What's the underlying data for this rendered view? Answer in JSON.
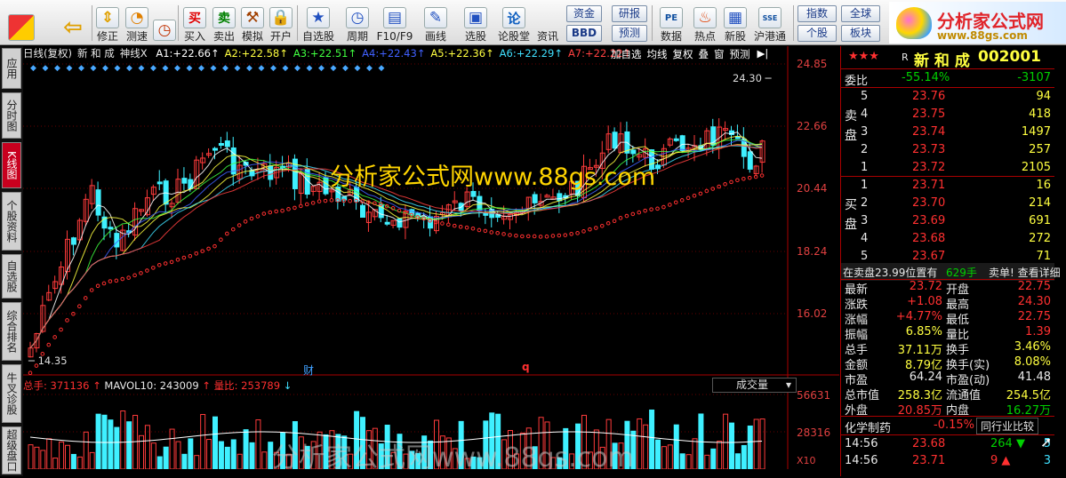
{
  "toolbar": {
    "buttons": [
      {
        "label": "",
        "icon": "home-icon"
      },
      {
        "label": "",
        "icon": "back-arrow-icon"
      },
      {
        "label": "修正",
        "icon": "up-down-icon"
      },
      {
        "label": "测速",
        "icon": "speed-icon"
      },
      {
        "label": "买入",
        "icon": "buy-icon"
      },
      {
        "label": "卖出",
        "icon": "sell-icon"
      },
      {
        "label": "模拟",
        "icon": "hammer-icon"
      },
      {
        "label": "开户",
        "icon": "lock-icon"
      },
      {
        "label": "自选股",
        "icon": "star-icon"
      },
      {
        "label": "周期",
        "icon": "clock-icon"
      },
      {
        "label": "F10/F9",
        "icon": "f10-icon"
      },
      {
        "label": "画线",
        "icon": "pen-icon"
      },
      {
        "label": "选股",
        "icon": "select-icon"
      },
      {
        "label": "论股堂",
        "icon": "forum-icon"
      },
      {
        "label": "资讯",
        "icon": "news-icon"
      },
      {
        "label": "数据",
        "icon": "pe-icon"
      },
      {
        "label": "热点",
        "icon": "hot-icon"
      },
      {
        "label": "新股",
        "icon": "newstock-icon"
      },
      {
        "label": "沪港通",
        "icon": "sse-hke-icon"
      }
    ],
    "small_buttons": [
      "资金",
      "BBD",
      "研报",
      "预测",
      "指数",
      "个股",
      "全球",
      "板块"
    ],
    "icon_glyphs": {
      "buy": "买",
      "sell": "卖",
      "forum": "论"
    }
  },
  "logo": {
    "title": "分析家公式网",
    "url": "www.88gs.com"
  },
  "left_tabs": [
    "应用",
    "分时图",
    "K线图",
    "个股资料",
    "自选股",
    "综合排名",
    "牛叉诊股",
    "超级盘口"
  ],
  "chart": {
    "period_label": "日线(复权)",
    "stock_name": "新 和 成",
    "indicator_name": "神线X",
    "ma": [
      {
        "label": "A1:",
        "value": "+22.66",
        "color": "#ffffff"
      },
      {
        "label": "A2:",
        "value": "+22.58",
        "color": "#ffff40"
      },
      {
        "label": "A3:",
        "value": "+22.51",
        "color": "#40ff40"
      },
      {
        "label": "A4:",
        "value": "+22.43",
        "color": "#4060ff"
      },
      {
        "label": "A5:",
        "value": "+22.36",
        "color": "#ffff40"
      },
      {
        "label": "A6:",
        "value": "+22.29",
        "color": "#40e0ff"
      },
      {
        "label": "A7:",
        "value": "+22.22",
        "color": "#ff4040"
      }
    ],
    "buttons": [
      "加自选",
      "均线",
      "复权",
      "叠",
      "窗",
      "预测"
    ],
    "price_axis": [
      "24.85",
      "22.66",
      "20.44",
      "18.24",
      "16.02"
    ],
    "high_label": "24.30",
    "low_label": "14.35",
    "markers": [
      "财",
      "q"
    ],
    "watermark": "分析家公式网www.88gs.com",
    "volume": {
      "total_label": "总手: 371136",
      "mavol_label": "MAVOL10: 243009",
      "ratio_label": "量比: 253789",
      "select": "成交量",
      "axis": [
        "56631",
        "28316"
      ],
      "unit": "X10"
    },
    "watermark_bottom": "分析家公式网www.88gs.com"
  },
  "quote": {
    "stars": "★★★",
    "r_flag": "R",
    "name": "新 和 成",
    "code": "002001",
    "weibi_label": "委比",
    "weibi_pct": "-55.14%",
    "weibi_val": "-3107",
    "sell_label": "卖盘",
    "buy_label": "买盘",
    "sells": [
      {
        "lvl": "5",
        "price": "23.76",
        "vol": "94"
      },
      {
        "lvl": "4",
        "price": "23.75",
        "vol": "418"
      },
      {
        "lvl": "3",
        "price": "23.74",
        "vol": "1497"
      },
      {
        "lvl": "2",
        "price": "23.73",
        "vol": "257"
      },
      {
        "lvl": "1",
        "price": "23.72",
        "vol": "2105"
      }
    ],
    "buys": [
      {
        "lvl": "1",
        "price": "23.71",
        "vol": "16"
      },
      {
        "lvl": "2",
        "price": "23.70",
        "vol": "214"
      },
      {
        "lvl": "3",
        "price": "23.69",
        "vol": "691"
      },
      {
        "lvl": "4",
        "price": "23.68",
        "vol": "272"
      },
      {
        "lvl": "5",
        "price": "23.67",
        "vol": "71"
      }
    ],
    "notice_a": "在卖盘23.99位置有",
    "notice_b": "629手",
    "notice_c": "卖单! 查看详细",
    "stats": [
      {
        "l1": "最新",
        "v1": "23.72",
        "c1": "r",
        "l2": "开盘",
        "v2": "22.75",
        "c2": "r"
      },
      {
        "l1": "涨跌",
        "v1": "+1.08",
        "c1": "r",
        "l2": "最高",
        "v2": "24.30",
        "c2": "r"
      },
      {
        "l1": "涨幅",
        "v1": "+4.77%",
        "c1": "r",
        "l2": "最低",
        "v2": "22.75",
        "c2": "r"
      },
      {
        "l1": "振幅",
        "v1": "6.85%",
        "c1": "y",
        "l2": "量比",
        "v2": "1.39",
        "c2": "r"
      },
      {
        "l1": "总手",
        "v1": "37.11万",
        "c1": "y",
        "l2": "换手",
        "v2": "3.46%",
        "c2": "y"
      },
      {
        "l1": "金额",
        "v1": "8.79亿",
        "c1": "y",
        "l2": "换手(实)",
        "v2": "8.08%",
        "c2": "y"
      },
      {
        "l1": "市盈",
        "v1": "64.24",
        "c1": "w",
        "l2": "市盈(动)",
        "v2": "41.48",
        "c2": "w"
      },
      {
        "l1": "总市值",
        "v1": "258.3亿",
        "c1": "y",
        "l2": "流通值",
        "v2": "254.5亿",
        "c2": "y"
      },
      {
        "l1": "外盘",
        "v1": "20.85万",
        "c1": "r",
        "l2": "内盘",
        "v2": "16.27万",
        "c2": "g"
      }
    ],
    "industry": "化学制药",
    "industry_pct": "-0.15%",
    "compare_button": "同行业比较",
    "ticks": [
      {
        "time": "14:56",
        "price": "23.68",
        "vol": "264",
        "arrow": "▼",
        "n": "5"
      },
      {
        "time": "14:56",
        "price": "23.71",
        "vol": "9",
        "arrow": "▲",
        "n": "3"
      }
    ]
  }
}
